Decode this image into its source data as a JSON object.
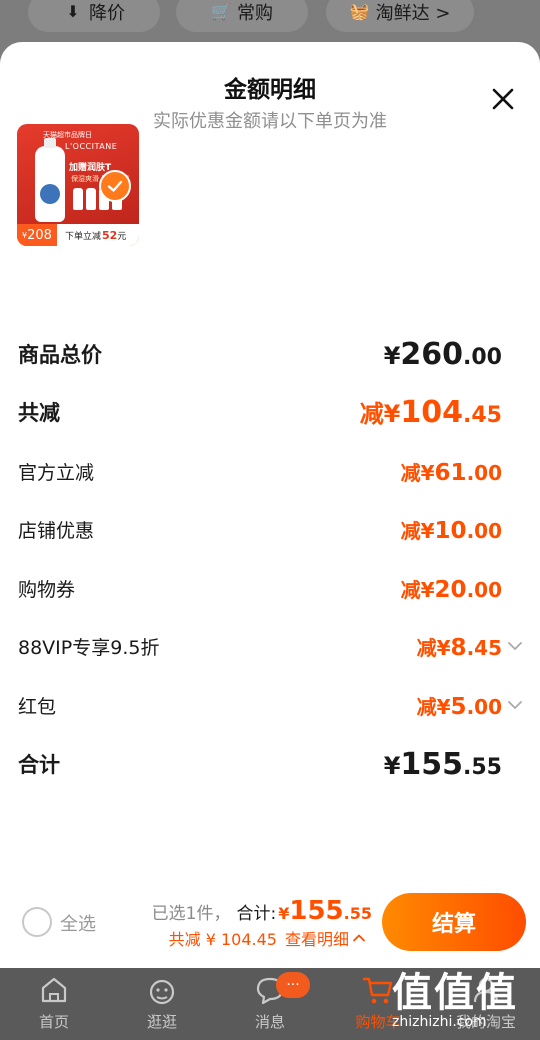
{
  "top_chips": [
    {
      "icon": "down-arrow-icon",
      "label": "降价"
    },
    {
      "icon": "cart-icon",
      "label": "常购"
    },
    {
      "icon": "basket-icon",
      "label": "淘鲜达 >"
    }
  ],
  "sheet": {
    "title": "金额明细",
    "subtitle": "实际优惠金额请以下单页为准"
  },
  "product": {
    "banner_text": "天猫超市品牌日",
    "brand": "L'OCCITANE",
    "promo": "加赠润肤T",
    "promo_sub": "保湿爽滑 深度保湿",
    "price_yen": "¥",
    "price": "208",
    "discount_label": "下单立减",
    "discount_value": "52",
    "discount_unit": "元",
    "selected": true
  },
  "rows": [
    {
      "label": "商品总价",
      "prefix": "¥",
      "int": "260",
      "dec": ".00"
    },
    {
      "label": "共减",
      "prefix": "减¥",
      "int": "104",
      "dec": ".45"
    },
    {
      "label": "官方立减",
      "prefix": "减¥",
      "int": "61",
      "dec": ".00"
    },
    {
      "label": "店铺优惠",
      "prefix": "减¥",
      "int": "10",
      "dec": ".00"
    },
    {
      "label": "购物券",
      "prefix": "减¥",
      "int": "20",
      "dec": ".00"
    },
    {
      "label": "88VIP专享9.5折",
      "prefix": "减¥",
      "int": "8",
      "dec": ".45"
    },
    {
      "label": "红包",
      "prefix": "减¥",
      "int": "5",
      "dec": ".00"
    },
    {
      "label": "合计",
      "prefix": "¥",
      "int": "155",
      "dec": ".55"
    }
  ],
  "bottom_bar": {
    "select_all": "全选",
    "selected_count": "已选1件，",
    "total_label": "合计:",
    "total_yen": "¥",
    "total_int": "155",
    "total_dec": ".55",
    "saved": "共减 ¥ 104.45",
    "view_detail": "查看明细",
    "checkout": "结算"
  },
  "tabbar": {
    "tabs": [
      "首页",
      "逛逛",
      "消息",
      "购物车",
      "我的淘宝"
    ],
    "message_badge": "···",
    "active_index": 3
  },
  "watermark": {
    "logo": "值值值",
    "url": "zhizhizhi.com"
  },
  "colors": {
    "accent": "#ff5000",
    "checkout_gradient_start": "#ff8a00",
    "checkout_gradient_end": "#ff4d00"
  }
}
